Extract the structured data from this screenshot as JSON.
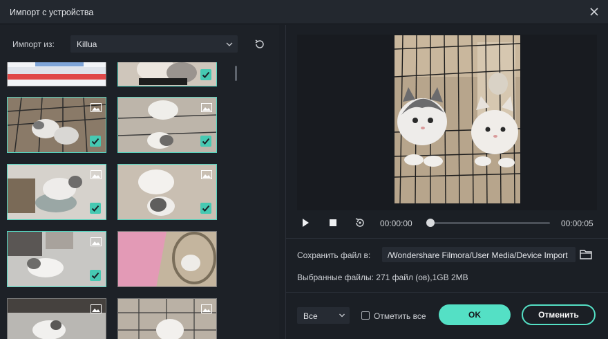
{
  "window": {
    "title": "Импорт с устройства"
  },
  "source": {
    "label": "Импорт из:",
    "value": "Killua"
  },
  "thumbnails": [
    {
      "checked": false
    },
    {
      "checked": true
    },
    {
      "checked": true
    },
    {
      "checked": true
    },
    {
      "checked": true
    },
    {
      "checked": true
    },
    {
      "checked": true
    },
    {
      "checked": false
    },
    {
      "checked": false
    },
    {
      "checked": false
    }
  ],
  "player": {
    "time_current": "00:00:00",
    "time_total": "00:00:05",
    "progress": 0
  },
  "save": {
    "label": "Сохранить файл в:",
    "path": "/Wondershare Filmora/User Media/Device Import"
  },
  "selected_info": "Выбранные файлы: 271 файл (ов),1GB 2MB",
  "footer": {
    "filter_value": "Все",
    "select_all_label": "Отметить все",
    "ok_label": "OK",
    "cancel_label": "Отменить"
  },
  "colors": {
    "accent": "#54e0c5",
    "background": "#1b1f25"
  },
  "icons": [
    "close-icon",
    "chevron-down-icon",
    "refresh-icon",
    "image-icon",
    "checkmark-icon",
    "play-icon",
    "stop-icon",
    "loop-icon",
    "folder-icon"
  ]
}
